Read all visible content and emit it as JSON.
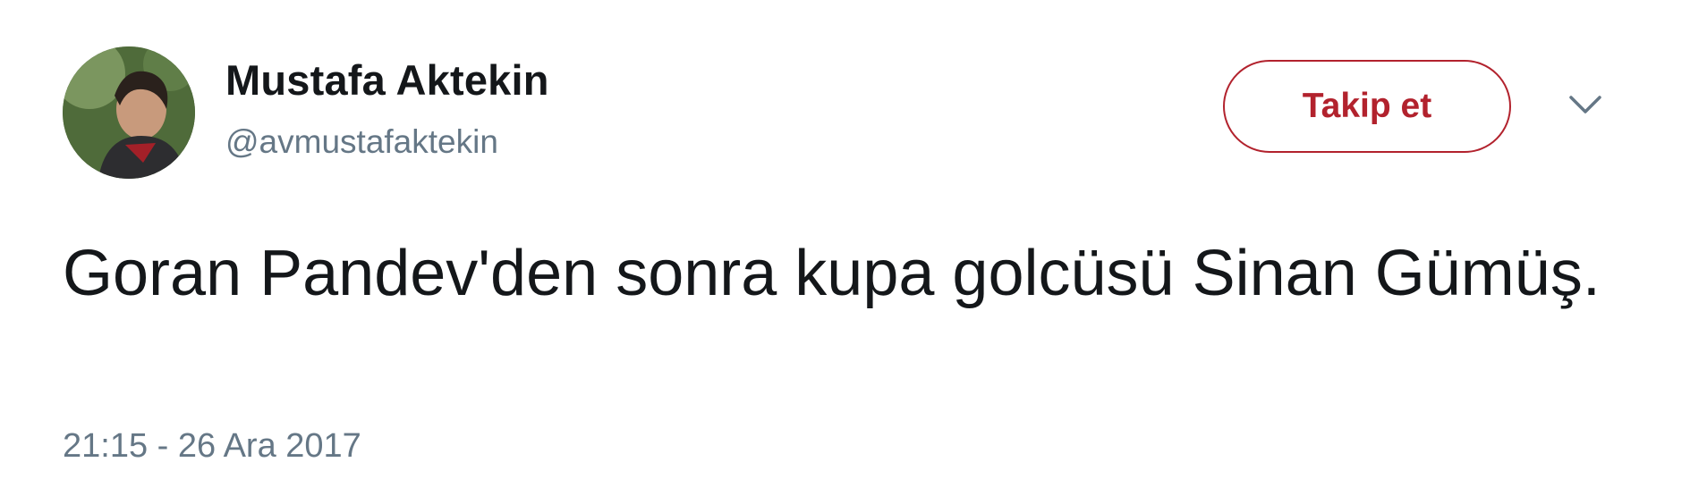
{
  "user": {
    "display_name": "Mustafa Aktekin",
    "handle": "@avmustafaktekin"
  },
  "actions": {
    "follow_label": "Takip et",
    "accent_color": "#b2222d"
  },
  "tweet": {
    "text": "Goran Pandev'den sonra kupa golcüsü Sinan Gümüş.",
    "timestamp": "21:15 - 26 Ara 2017"
  },
  "icons": {
    "menu": "chevron-down-icon",
    "avatar": "user-avatar"
  }
}
